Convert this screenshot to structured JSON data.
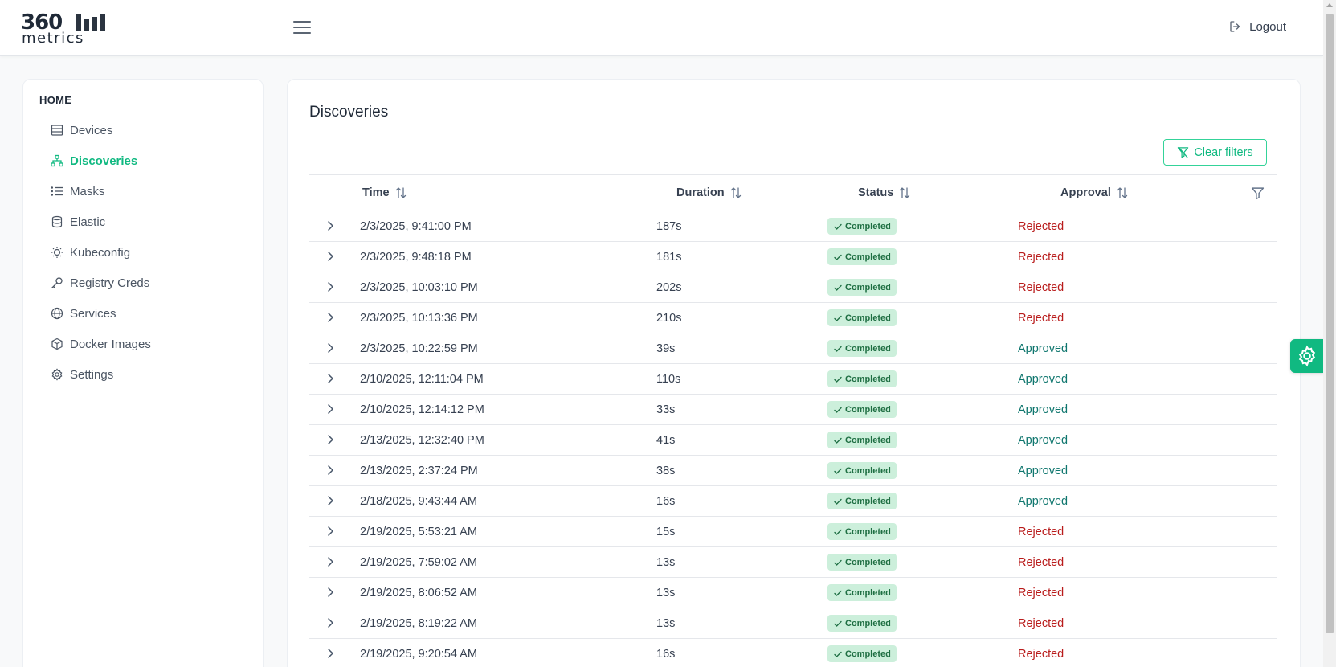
{
  "header": {
    "logo_top": "360",
    "logo_bottom": "metrics",
    "logout_label": "Logout"
  },
  "sidebar": {
    "heading": "HOME",
    "items": [
      {
        "label": "Devices",
        "icon": "devices-icon",
        "active": false
      },
      {
        "label": "Discoveries",
        "icon": "sitemap-icon",
        "active": true
      },
      {
        "label": "Masks",
        "icon": "list-icon",
        "active": false
      },
      {
        "label": "Elastic",
        "icon": "database-icon",
        "active": false
      },
      {
        "label": "Kubeconfig",
        "icon": "sun-icon",
        "active": false
      },
      {
        "label": "Registry Creds",
        "icon": "key-icon",
        "active": false
      },
      {
        "label": "Services",
        "icon": "globe-icon",
        "active": false
      },
      {
        "label": "Docker Images",
        "icon": "box-icon",
        "active": false
      },
      {
        "label": "Settings",
        "icon": "gear-icon",
        "active": false
      }
    ]
  },
  "main": {
    "title": "Discoveries",
    "clear_filters_label": "Clear filters",
    "columns": [
      "Time",
      "Duration",
      "Status",
      "Approval"
    ],
    "rows": [
      {
        "time": "2/3/2025, 9:41:00 PM",
        "duration": "187s",
        "status": "Completed",
        "approval": "Rejected"
      },
      {
        "time": "2/3/2025, 9:48:18 PM",
        "duration": "181s",
        "status": "Completed",
        "approval": "Rejected"
      },
      {
        "time": "2/3/2025, 10:03:10 PM",
        "duration": "202s",
        "status": "Completed",
        "approval": "Rejected"
      },
      {
        "time": "2/3/2025, 10:13:36 PM",
        "duration": "210s",
        "status": "Completed",
        "approval": "Rejected"
      },
      {
        "time": "2/3/2025, 10:22:59 PM",
        "duration": "39s",
        "status": "Completed",
        "approval": "Approved"
      },
      {
        "time": "2/10/2025, 12:11:04 PM",
        "duration": "110s",
        "status": "Completed",
        "approval": "Approved"
      },
      {
        "time": "2/10/2025, 12:14:12 PM",
        "duration": "33s",
        "status": "Completed",
        "approval": "Approved"
      },
      {
        "time": "2/13/2025, 12:32:40 PM",
        "duration": "41s",
        "status": "Completed",
        "approval": "Approved"
      },
      {
        "time": "2/13/2025, 2:37:24 PM",
        "duration": "38s",
        "status": "Completed",
        "approval": "Approved"
      },
      {
        "time": "2/18/2025, 9:43:44 AM",
        "duration": "16s",
        "status": "Completed",
        "approval": "Approved"
      },
      {
        "time": "2/19/2025, 5:53:21 AM",
        "duration": "15s",
        "status": "Completed",
        "approval": "Rejected"
      },
      {
        "time": "2/19/2025, 7:59:02 AM",
        "duration": "13s",
        "status": "Completed",
        "approval": "Rejected"
      },
      {
        "time": "2/19/2025, 8:06:52 AM",
        "duration": "13s",
        "status": "Completed",
        "approval": "Rejected"
      },
      {
        "time": "2/19/2025, 8:19:22 AM",
        "duration": "13s",
        "status": "Completed",
        "approval": "Rejected"
      },
      {
        "time": "2/19/2025, 9:20:54 AM",
        "duration": "16s",
        "status": "Completed",
        "approval": "Rejected"
      }
    ]
  },
  "colors": {
    "accent": "#10b981",
    "rejected": "#b91c1c",
    "approved": "#0f766e",
    "badge_bg": "#ccefdb"
  }
}
